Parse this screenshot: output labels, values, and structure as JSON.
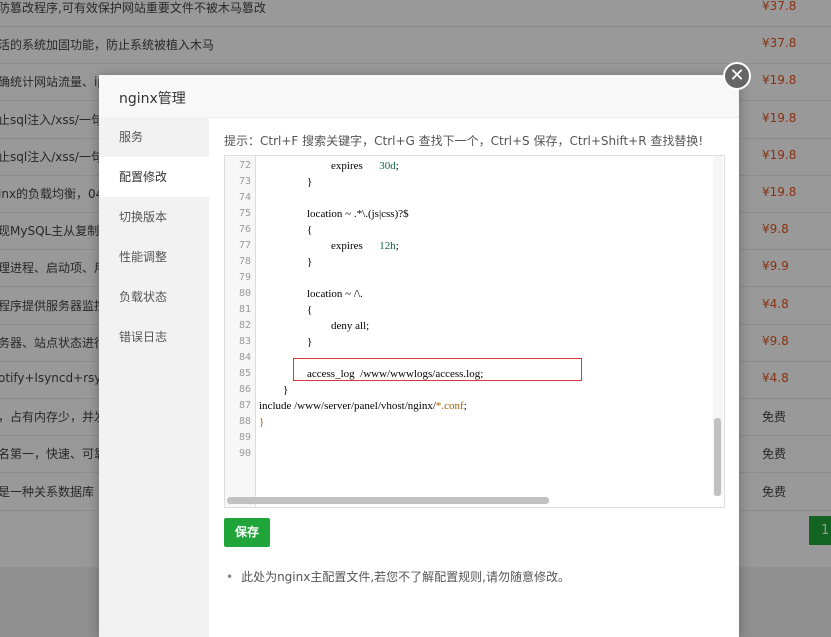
{
  "background_list": [
    {
      "desc": "防篡改程序,可有效保护网站重要文件不被木马篡改",
      "price": "¥37.8",
      "type": "paid"
    },
    {
      "desc": "活的系统加固功能，防止系统被植入木马",
      "price": "¥37.8",
      "type": "paid"
    },
    {
      "desc": "确统计网站流量、ip",
      "price": "¥19.8",
      "type": "paid"
    },
    {
      "desc": "止sql注入/xss/一句",
      "price": "¥19.8",
      "type": "paid"
    },
    {
      "desc": "止sql注入/xss/一句",
      "price": "¥19.8",
      "type": "paid"
    },
    {
      "desc": "inx的负载均衡，04",
      "price": "¥19.8",
      "type": "paid"
    },
    {
      "desc": "现MySQL主从复制",
      "price": "¥9.8",
      "type": "paid"
    },
    {
      "desc": "理进程、启动项、用",
      "price": "¥9.9",
      "type": "paid"
    },
    {
      "desc": "程序提供服务器监控",
      "price": "¥4.8",
      "type": "paid"
    },
    {
      "desc": "务器、站点状态进行",
      "price": "¥9.8",
      "type": "paid"
    },
    {
      "desc": "otify+lsyncd+rsyn",
      "price": "¥4.8",
      "type": "paid"
    },
    {
      "desc": "，占有内存少，并发",
      "price": "免费",
      "type": "free"
    },
    {
      "desc": "名第一，快速、可靠",
      "price": "免费",
      "type": "free"
    },
    {
      "desc": "是一种关系数据库",
      "price": "免费",
      "type": "free"
    }
  ],
  "pagination": {
    "current": "1"
  },
  "modal": {
    "title": "nginx管理",
    "close_glyph": "✕",
    "sidebar": [
      "服务",
      "配置修改",
      "切换版本",
      "性能调整",
      "负载状态",
      "错误日志"
    ],
    "active_index": 1,
    "tip": "提示：Ctrl+F 搜索关键字，Ctrl+G 查找下一个，Ctrl+S 保存，Ctrl+Shift+R 查找替换!",
    "editor": {
      "line_numbers": [
        "72",
        "73",
        "74",
        "75",
        "76",
        "77",
        "78",
        "79",
        "80",
        "81",
        "82",
        "83",
        "84",
        "85",
        "86",
        "87",
        "88",
        "89",
        "90"
      ],
      "lines": [
        {
          "indent": 3,
          "text": "expires",
          "value": "30d",
          "suffix": ";"
        },
        {
          "indent": 2,
          "text": "}"
        },
        {
          "indent": 0,
          "text": ""
        },
        {
          "indent": 2,
          "text": "location ~ .*\\.(js|css)?$"
        },
        {
          "indent": 2,
          "text": "{"
        },
        {
          "indent": 3,
          "text": "expires",
          "value": "12h",
          "suffix": ";"
        },
        {
          "indent": 2,
          "text": "}"
        },
        {
          "indent": 0,
          "text": ""
        },
        {
          "indent": 2,
          "text": "location ~ /\\."
        },
        {
          "indent": 2,
          "text": "{"
        },
        {
          "indent": 3,
          "text": "deny all;"
        },
        {
          "indent": 2,
          "text": "}"
        },
        {
          "indent": 0,
          "text": ""
        },
        {
          "indent": 2,
          "text": "access_log  /www/wwwlogs/access.log;"
        },
        {
          "indent": 1,
          "text": "}"
        },
        {
          "indent": 0,
          "text": "include /www/server/panel/vhost/nginx/",
          "glob": "*.conf",
          "suffix": ";"
        },
        {
          "indent": 0,
          "text": "}",
          "brace_color": "#a65e00"
        },
        {
          "indent": 0,
          "text": ""
        },
        {
          "indent": 0,
          "text": ""
        }
      ]
    },
    "save_label": "保存",
    "note": "此处为nginx主配置文件,若您不了解配置规则,请勿随意修改。"
  }
}
